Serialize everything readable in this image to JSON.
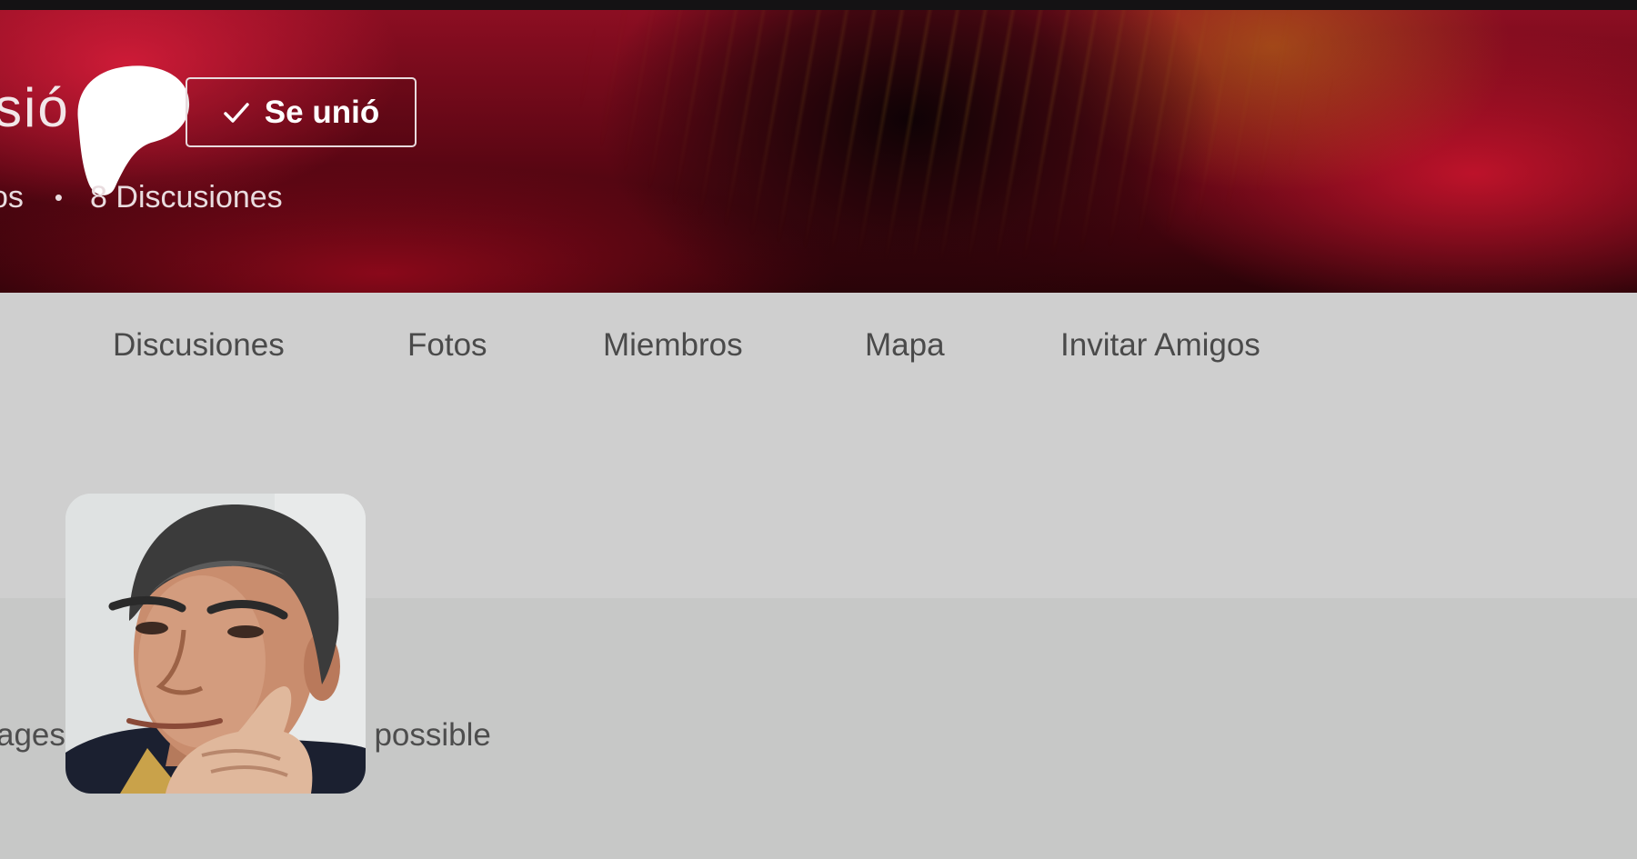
{
  "header": {
    "title_fragment": "sió",
    "join_button_label": "Se unió",
    "stats": {
      "members_fragment": "os",
      "separator": "•",
      "discussions": "8 Discusiones"
    }
  },
  "nav": {
    "items": [
      {
        "label": "Discusiones"
      },
      {
        "label": "Fotos"
      },
      {
        "label": "Miembros"
      },
      {
        "label": "Mapa"
      },
      {
        "label": "Invitar Amigos"
      }
    ]
  },
  "description": {
    "left_fragment": "ages",
    "right_fragment": "t possible"
  },
  "colors": {
    "banner": "#7a0c1c",
    "nav_background": "#cfcfcf",
    "content_background": "#c7c8c7",
    "nav_text": "#4a4a4a"
  },
  "icons": {
    "join": "check-icon",
    "avatar": "user-photo"
  }
}
